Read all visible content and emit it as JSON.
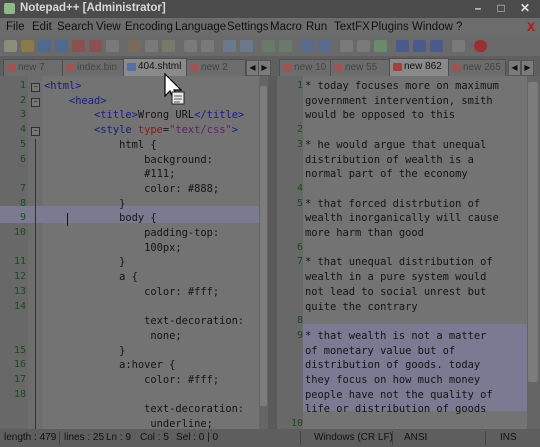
{
  "window": {
    "title": "Notepad++ [Administrator]",
    "controls": [
      "–",
      "□",
      "✕"
    ]
  },
  "menu": [
    "File",
    "Edit",
    "Search",
    "View",
    "Encoding",
    "Language",
    "Settings",
    "Macro",
    "Run",
    "TextFX",
    "Plugins",
    "Window",
    "?"
  ],
  "menu_close": "X",
  "tabs_left": [
    {
      "label": "new 7",
      "active": false
    },
    {
      "label": "index.bin",
      "active": false
    },
    {
      "label": "404.shtml",
      "active": true
    },
    {
      "label": "new 2",
      "active": false
    }
  ],
  "tabs_right": [
    {
      "label": "new 10",
      "active": false
    },
    {
      "label": "new 55",
      "active": false
    },
    {
      "label": "new 862",
      "active": true
    },
    {
      "label": "new 265",
      "active": false
    }
  ],
  "left_editor": {
    "lines": [
      {
        "n": "1",
        "text": "<html>"
      },
      {
        "n": "2",
        "text": "    <head>"
      },
      {
        "n": "3",
        "text": "        <title>Wrong URL</title>"
      },
      {
        "n": "4",
        "text": "        <style type=\"text/css\">"
      },
      {
        "n": "5",
        "text": "            html {"
      },
      {
        "n": "6",
        "text": "                background:"
      },
      {
        "n": "",
        "text": "                #111;"
      },
      {
        "n": "7",
        "text": "                color: #888;"
      },
      {
        "n": "8",
        "text": "            }"
      },
      {
        "n": "9",
        "text": "            body {"
      },
      {
        "n": "10",
        "text": "                padding-top:"
      },
      {
        "n": "",
        "text": "                100px;"
      },
      {
        "n": "11",
        "text": "            }"
      },
      {
        "n": "12",
        "text": "            a {"
      },
      {
        "n": "13",
        "text": "                color: #fff;"
      },
      {
        "n": "14",
        "text": ""
      },
      {
        "n": "",
        "text": "                text-decoration:"
      },
      {
        "n": "",
        "text": "                 none;"
      },
      {
        "n": "15",
        "text": "            }"
      },
      {
        "n": "16",
        "text": "            a:hover {"
      },
      {
        "n": "17",
        "text": "                color: #fff;"
      },
      {
        "n": "18",
        "text": ""
      },
      {
        "n": "",
        "text": "                text-decoration:"
      },
      {
        "n": "",
        "text": "                 underline;"
      }
    ]
  },
  "right_editor": {
    "lines": [
      {
        "n": "1",
        "text": "* today focuses more on maximum"
      },
      {
        "n": "",
        "text": "government intervention, smith"
      },
      {
        "n": "",
        "text": "would be opposed to this"
      },
      {
        "n": "2",
        "text": ""
      },
      {
        "n": "3",
        "text": "* he would argue that unequal"
      },
      {
        "n": "",
        "text": "distribution of wealth is a"
      },
      {
        "n": "",
        "text": "normal part of the economy"
      },
      {
        "n": "4",
        "text": ""
      },
      {
        "n": "5",
        "text": "* that forced distrbution of"
      },
      {
        "n": "",
        "text": "wealth inorganically will cause"
      },
      {
        "n": "",
        "text": "more harm than good"
      },
      {
        "n": "6",
        "text": ""
      },
      {
        "n": "7",
        "text": "* that unequal distribution of"
      },
      {
        "n": "",
        "text": "wealth in a pure system would"
      },
      {
        "n": "",
        "text": "not lead to social unrest but"
      },
      {
        "n": "",
        "text": "quite the contrary"
      },
      {
        "n": "8",
        "text": ""
      },
      {
        "n": "9",
        "text": "* that wealth is not a matter"
      },
      {
        "n": "",
        "text": "of monetary value but of"
      },
      {
        "n": "",
        "text": "distribution of goods. today"
      },
      {
        "n": "",
        "text": "they focus on how much money"
      },
      {
        "n": "",
        "text": "people have not the quality of"
      },
      {
        "n": "",
        "text": "life or distribution of goods"
      },
      {
        "n": "10",
        "text": ""
      }
    ]
  },
  "status": {
    "length": "length : 479",
    "lines": "lines : 25",
    "ln": "Ln : 9",
    "col": "Col : 5",
    "sel": "Sel : 0 | 0",
    "eol": "Windows (CR LF)",
    "encoding": "ANSI",
    "mode": "INS"
  },
  "colors": {
    "tag": "#1a1a85",
    "attribute": "#8a1a1a",
    "string": "#6a1a6a",
    "line_numbers": "#1d4a1d",
    "active_line": "#7a7a90"
  }
}
